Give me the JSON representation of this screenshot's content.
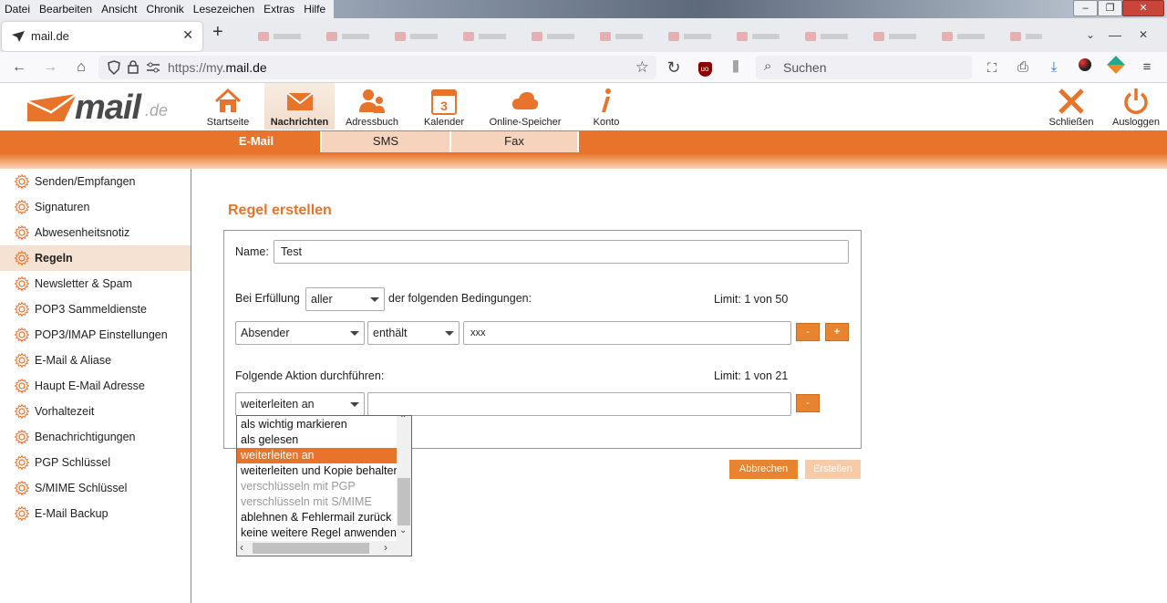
{
  "menubar": {
    "items": [
      "Datei",
      "Bearbeiten",
      "Ansicht",
      "Chronik",
      "Lesezeichen",
      "Extras",
      "Hilfe"
    ]
  },
  "browser": {
    "tab_title": "mail.de",
    "url_prefix": "https://my.",
    "url_domain": "mail.de",
    "search_placeholder": "Suchen"
  },
  "topnav": {
    "items": [
      {
        "label": "Startseite",
        "icon": "house-icon"
      },
      {
        "label": "Nachrichten",
        "icon": "envelope-icon"
      },
      {
        "label": "Adressbuch",
        "icon": "contacts-icon"
      },
      {
        "label": "Kalender",
        "icon": "calendar-icon",
        "badge": "3"
      },
      {
        "label": "Online-Speicher",
        "icon": "cloud-icon"
      },
      {
        "label": "Konto",
        "icon": "info-icon"
      }
    ],
    "close_label": "Schließen",
    "logout_label": "Ausloggen"
  },
  "subtabs": [
    "E-Mail",
    "SMS",
    "Fax"
  ],
  "sidebar": {
    "items": [
      "Senden/Empfangen",
      "Signaturen",
      "Abwesenheitsnotiz",
      "Regeln",
      "Newsletter & Spam",
      "POP3 Sammeldienste",
      "POP3/IMAP Einstellungen",
      "E-Mail & Aliase",
      "Haupt E-Mail Adresse",
      "Vorhaltezeit",
      "Benachrichtigungen",
      "PGP Schlüssel",
      "S/MIME Schlüssel",
      "E-Mail Backup"
    ],
    "active_index": 3
  },
  "form": {
    "heading": "Regel erstellen",
    "name_label": "Name:",
    "name_value": "Test",
    "condition_prefix": "Bei Erfüllung",
    "condition_mode": "aller",
    "condition_suffix": "der folgenden Bedingungen:",
    "condition_limit": "Limit:  1 von 50",
    "cond_field": "Absender",
    "cond_op": "enthält",
    "cond_value": "xxx",
    "minus": "-",
    "plus": "+",
    "action_label": "Folgende Aktion durchführen:",
    "action_limit": "Limit:  1 von 21",
    "action_value": "weiterleiten an",
    "action_target": "",
    "cancel_label": "Abbrechen",
    "create_label": "Erstellen"
  },
  "dropdown": {
    "options": [
      "als wichtig markieren",
      "als gelesen",
      "weiterleiten an",
      "weiterleiten und Kopie behalten",
      "verschlüsseln mit PGP",
      "verschlüsseln mit S/MIME",
      "ablehnen & Fehlermail zurück",
      "keine weitere Regel anwenden"
    ],
    "selected_index": 2,
    "disabled_indices": [
      4,
      5
    ]
  },
  "colors": {
    "accent": "#e8732a",
    "accent_light": "#f6d3bc"
  }
}
